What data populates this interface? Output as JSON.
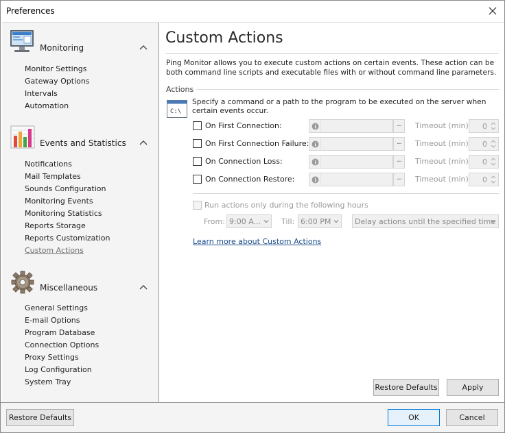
{
  "window": {
    "title": "Preferences"
  },
  "sidebar": {
    "sections": [
      {
        "title": "Monitoring",
        "icon": "monitor-icon",
        "items": [
          "Monitor Settings",
          "Gateway Options",
          "Intervals",
          "Automation"
        ]
      },
      {
        "title": "Events and Statistics",
        "icon": "bar-chart-icon",
        "items": [
          "Notifications",
          "Mail Templates",
          "Sounds Configuration",
          "Monitoring Events",
          "Monitoring Statistics",
          "Reports Storage",
          "Reports Customization",
          "Custom Actions"
        ]
      },
      {
        "title": "Miscellaneous",
        "icon": "gear-icon",
        "items": [
          "General Settings",
          "E-mail Options",
          "Program Database",
          "Connection Options",
          "Proxy Settings",
          "Log Configuration",
          "System Tray"
        ]
      }
    ],
    "active_item": "Custom Actions"
  },
  "main": {
    "title": "Custom Actions",
    "intro": "Ping Monitor allows you to execute custom actions on certain events. These action can be both command line scripts and executable files with or without command line parameters.",
    "group_label": "Actions",
    "command_icon_text": "C:\\",
    "command_description": "Specify a command or a path to the program to be executed on the server when certain events occur.",
    "events": [
      {
        "label": "On First Connection:",
        "checked": false,
        "path": "",
        "timeout_label": "Timeout (min):",
        "timeout": "0"
      },
      {
        "label": "On First Connection Failure:",
        "checked": false,
        "path": "",
        "timeout_label": "Timeout (min):",
        "timeout": "0"
      },
      {
        "label": "On Connection Loss:",
        "checked": false,
        "path": "",
        "timeout_label": "Timeout (min):",
        "timeout": "0"
      },
      {
        "label": "On Connection Restore:",
        "checked": false,
        "path": "",
        "timeout_label": "Timeout (min):",
        "timeout": "0"
      }
    ],
    "browse_label": "···",
    "hours": {
      "label": "Run actions only during the following hours",
      "checked": false,
      "from_label": "From:",
      "from_value": "9:00 A...",
      "till_label": "Till:",
      "till_value": "6:00 PM",
      "delay_value": "Delay actions until the specified time"
    },
    "learn_more": "Learn more about Custom Actions",
    "restore_defaults": "Restore Defaults",
    "apply": "Apply"
  },
  "footer": {
    "restore_defaults": "Restore Defaults",
    "ok": "OK",
    "cancel": "Cancel"
  }
}
